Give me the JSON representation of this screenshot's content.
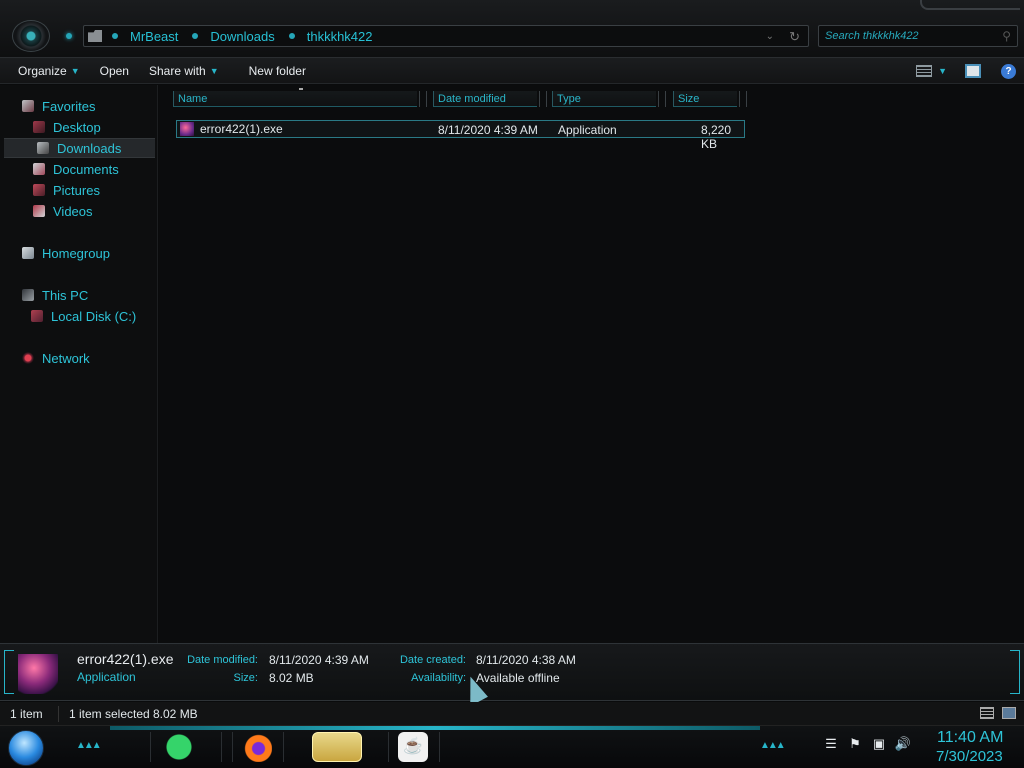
{
  "address": {
    "crumbs": [
      "MrBeast",
      "Downloads",
      "thkkkhk422"
    ],
    "search_placeholder": "Search thkkkhk422"
  },
  "toolbar": {
    "organize": "Organize",
    "open": "Open",
    "share_with": "Share with",
    "new_folder": "New folder"
  },
  "sidebar": {
    "favorites": "Favorites",
    "desktop": "Desktop",
    "downloads": "Downloads",
    "documents": "Documents",
    "pictures": "Pictures",
    "videos": "Videos",
    "homegroup": "Homegroup",
    "this_pc": "This PC",
    "local_disk": "Local Disk (C:)",
    "network": "Network"
  },
  "columns": {
    "name": "Name",
    "date_modified": "Date modified",
    "type": "Type",
    "size": "Size"
  },
  "files": [
    {
      "name": "error422(1).exe",
      "date_modified": "8/11/2020 4:39 AM",
      "type": "Application",
      "size": "8,220 KB"
    }
  ],
  "details": {
    "name": "error422(1).exe",
    "type": "Application",
    "date_modified_label": "Date modified:",
    "date_modified": "8/11/2020 4:39 AM",
    "size_label": "Size:",
    "size": "8.02 MB",
    "date_created_label": "Date created:",
    "date_created": "8/11/2020 4:38 AM",
    "availability_label": "Availability:",
    "availability": "Available offline"
  },
  "status": {
    "item_count": "1 item",
    "selected": "1 item selected",
    "selected_size": "8.02 MB"
  },
  "clock": {
    "time": "11:40 AM",
    "date": "7/30/2023"
  },
  "colors": {
    "accent": "#2ec4d8",
    "background": "#0a0b0c"
  }
}
